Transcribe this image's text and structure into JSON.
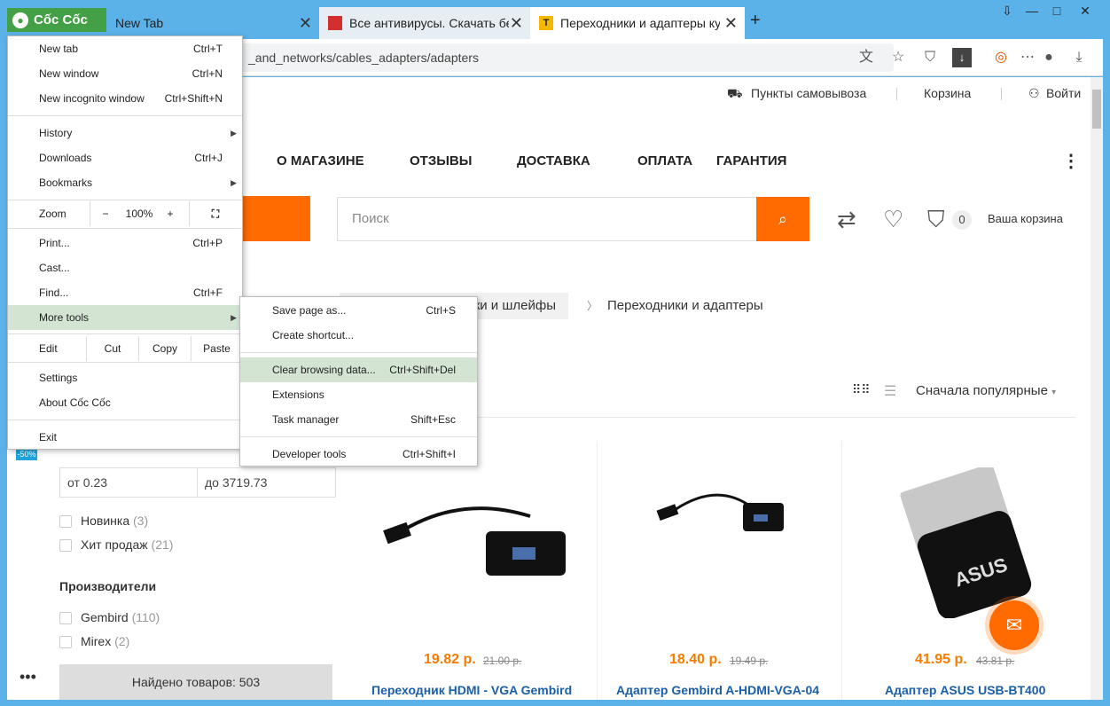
{
  "browser": {
    "logo_text": "Cốc Cốc",
    "tabs": [
      {
        "title": "New Tab",
        "close": "✕"
      },
      {
        "title": "Все антивирусы. Скачать бес",
        "close": "✕"
      },
      {
        "title": "Переходники и адаптеры ку",
        "close": "✕"
      }
    ],
    "new_tab_symbol": "+",
    "url": "_and_networks/cables_adapters/adapters"
  },
  "menu": {
    "new_tab": {
      "label": "New tab",
      "shortcut": "Ctrl+T"
    },
    "new_window": {
      "label": "New window",
      "shortcut": "Ctrl+N"
    },
    "new_incognito": {
      "label": "New incognito window",
      "shortcut": "Ctrl+Shift+N"
    },
    "history": {
      "label": "History"
    },
    "downloads": {
      "label": "Downloads",
      "shortcut": "Ctrl+J"
    },
    "bookmarks": {
      "label": "Bookmarks"
    },
    "zoom": {
      "label": "Zoom",
      "minus": "−",
      "value": "100%",
      "plus": "+"
    },
    "print": {
      "label": "Print...",
      "shortcut": "Ctrl+P"
    },
    "cast": {
      "label": "Cast..."
    },
    "find": {
      "label": "Find...",
      "shortcut": "Ctrl+F"
    },
    "more_tools": {
      "label": "More tools"
    },
    "edit": {
      "label": "Edit",
      "cut": "Cut",
      "copy": "Copy",
      "paste": "Paste"
    },
    "settings": {
      "label": "Settings"
    },
    "about": {
      "label": "About Cốc Cốc"
    },
    "exit": {
      "label": "Exit"
    }
  },
  "submenu": {
    "save_page": {
      "label": "Save page as...",
      "shortcut": "Ctrl+S"
    },
    "create_shortcut": {
      "label": "Create shortcut..."
    },
    "clear_browsing": {
      "label": "Clear browsing data...",
      "shortcut": "Ctrl+Shift+Del"
    },
    "extensions": {
      "label": "Extensions"
    },
    "task_manager": {
      "label": "Task manager",
      "shortcut": "Shift+Esc"
    },
    "developer_tools": {
      "label": "Developer tools",
      "shortcut": "Ctrl+Shift+I"
    }
  },
  "site": {
    "top_links": {
      "pickup": "Пункты самовывоза",
      "cart": "Корзина",
      "login": "Войти"
    },
    "nav": [
      "О МАГАЗИНЕ",
      "ОТЗЫВЫ",
      "ДОСТАВКА",
      "ОПЛАТА",
      "ГАРАНТИЯ"
    ],
    "search_placeholder": "Поиск",
    "cart_count": "0",
    "cart_label": "Ваша корзина",
    "breadcrumbs": {
      "cables": "ки и шлейфы",
      "current": "Переходники и адаптеры"
    },
    "sort_label": "Сначала популярные",
    "sale_badge": "-50%",
    "filter": {
      "price_from": "от  0.23",
      "price_to": "до  3719.73",
      "checks": [
        {
          "label": "Новинка",
          "count": "(3)"
        },
        {
          "label": "Хит продаж",
          "count": "(21)"
        }
      ],
      "makers_title": "Производители",
      "makers": [
        {
          "label": "Gembird",
          "count": "(110)"
        },
        {
          "label": "Mirex",
          "count": "(2)"
        }
      ],
      "found": "Найдено товаров: 503"
    },
    "products": [
      {
        "price": "19.82 р.",
        "old_price": "21.00 р.",
        "title": "Переходник HDMI - VGA Gembird"
      },
      {
        "price": "18.40 р.",
        "old_price": "19.49 р.",
        "title": "Адаптер Gembird A-HDMI-VGA-04"
      },
      {
        "price": "41.95 р.",
        "old_price": "43.81 р.",
        "title": "Адаптер ASUS USB-BT400"
      }
    ]
  },
  "colors": {
    "accent": "#ff6b00",
    "frame": "#5bb2e8",
    "menu_highlight": "#d3e4d3"
  }
}
